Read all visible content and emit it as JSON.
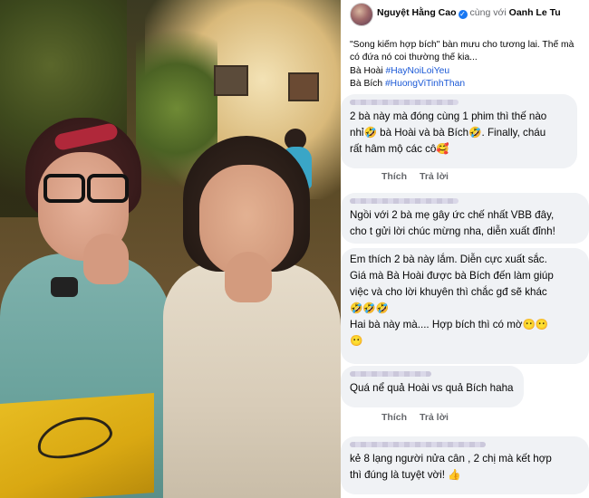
{
  "post": {
    "author": "Nguyệt Hằng Cao",
    "with_text": "cùng với",
    "tagged": "Oanh Le Tu",
    "caption": "\"Song kiếm hợp bích\" bàn mưu cho tương lai. Thế mà có đứa nó coi thường thế kia...",
    "line1_prefix": "Bà Hoài",
    "line1_tag": "#HayNoiLoiYeu",
    "line2_prefix": "Bà Bích",
    "line2_tag": "#HuongViTinhThan"
  },
  "comments": [
    {
      "l1": "2 bà này mà đóng cùng 1 phim thì thế nào",
      "l2": "nhỉ🤣 bà Hoài và bà Bích🤣. Finally, cháu",
      "l3": "rất hâm mộ các cô🥰"
    },
    {
      "l1": "Ngồi với 2 bà mẹ gây ức chế nhất VBB đây,",
      "l2": "cho t gửi lời chúc mừng nha, diễn xuất đỉnh!"
    },
    {
      "l1": "Em thích 2 bà này lắm. Diễn cực xuất sắc.",
      "l2": "Giá mà Bà Hoài được bà Bích đến làm giúp",
      "l3": "việc và cho lời khuyên thì chắc gđ sẽ khác",
      "l4": "🤣🤣🤣"
    },
    {
      "l1": "Hai bà này mà.... Hợp bích thì có mờ😶😶",
      "l2": "😶"
    },
    {
      "l1": "Quá nể quả Hoài vs quả Bích haha"
    },
    {
      "l1": "kẻ 8 lạng người nửa cân , 2 chị mà kết hợp",
      "l2": "thì đúng là tuyệt vời! 👍"
    }
  ],
  "actions": {
    "like": "Thích",
    "reply": "Trả lời"
  },
  "icons": {
    "verified": "verified-badge-icon",
    "avatar": "profile-avatar"
  },
  "colors": {
    "hashtag": "#1a58d6",
    "bubble": "#f0f2f5",
    "muted": "#65676b",
    "verified": "#1877f2"
  }
}
